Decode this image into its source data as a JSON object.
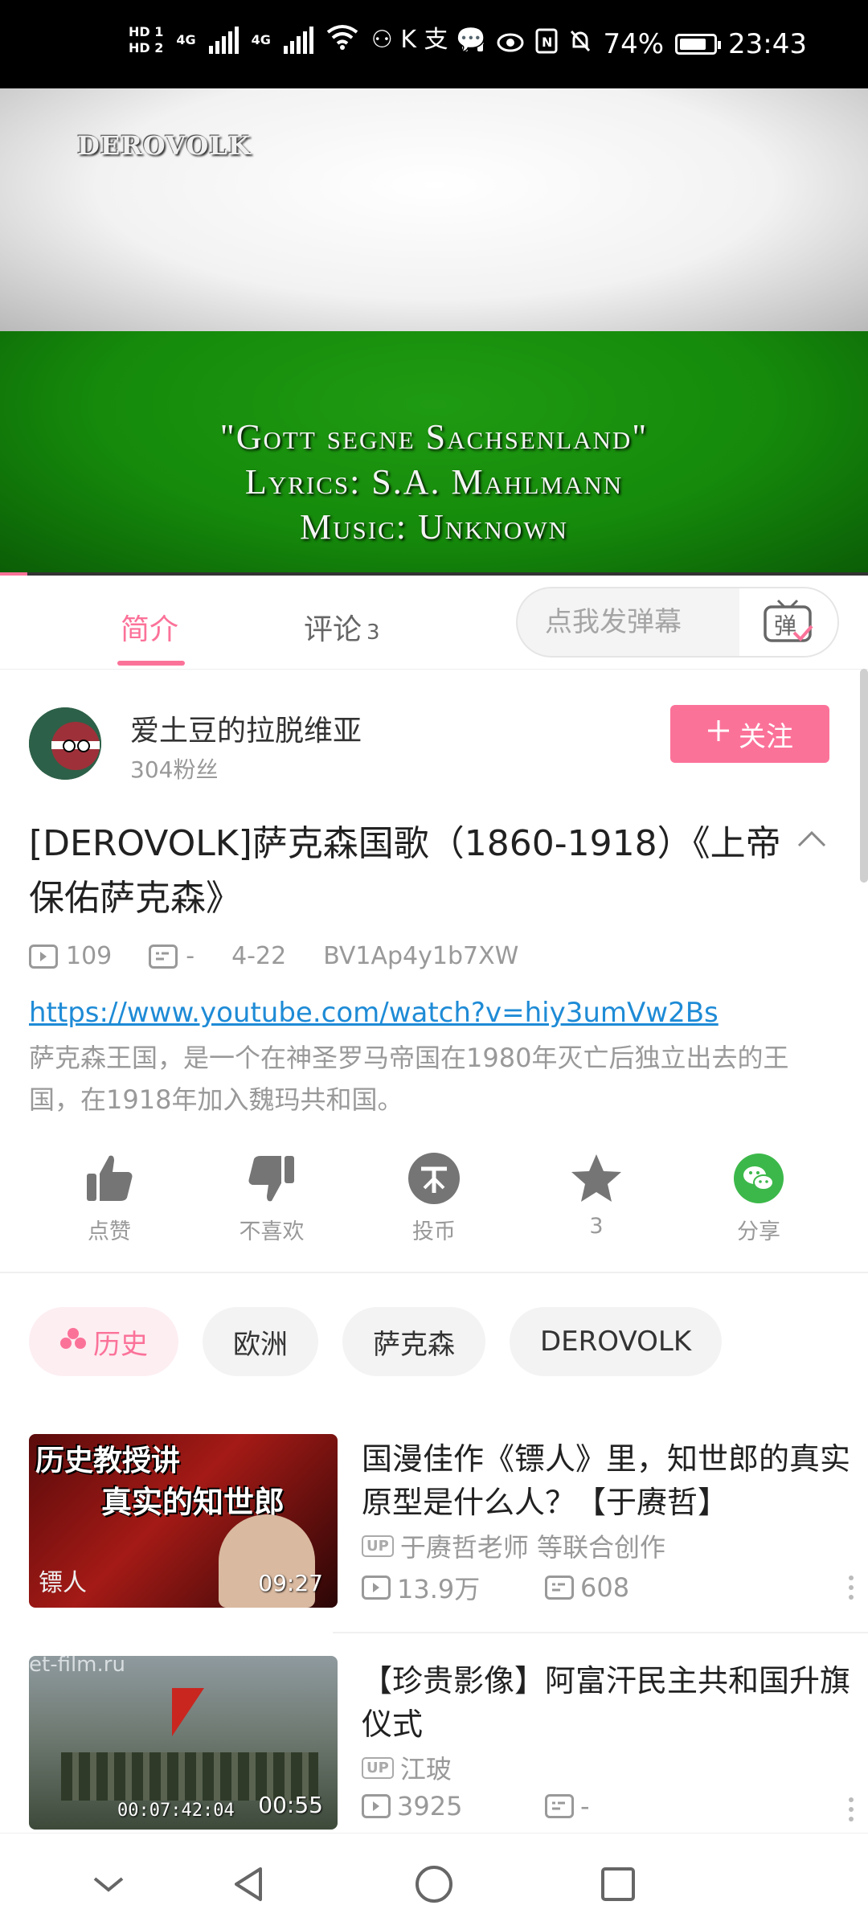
{
  "status_bar": {
    "hd1": "HD 1",
    "hd2": "HD 2",
    "net1": "4G",
    "net2": "4G",
    "app_glyphs": "⚇ K 支 💬",
    "battery": "74%",
    "time": "23:43"
  },
  "video": {
    "watermark": "DEROVOLK",
    "caption_line1": "\"Gott segne Sachsenland\"",
    "caption_line2": "Lyrics: S.A. Mahlmann",
    "caption_line3": "Music: Unknown",
    "flag_colors": {
      "top": "#ffffff",
      "bottom": "#1a9410"
    }
  },
  "tabs": {
    "intro": "简介",
    "comments": "评论",
    "comments_count": "3"
  },
  "danmaku": {
    "placeholder": "点我发弹幕",
    "button_glyph": "弹"
  },
  "uploader": {
    "name": "爱土豆的拉脱维亚",
    "fans": "304粉丝",
    "follow_label": "关注"
  },
  "video_info": {
    "title": "[DEROVOLK]萨克森国歌（1860-1918）《上帝保佑萨克森》",
    "views": "109",
    "danmaku_count": "-",
    "date": "4-22",
    "bvid": "BV1Ap4y1b7XW",
    "link": "https://www.youtube.com/watch?v=hiy3umVw2Bs",
    "description": "萨克森王国，是一个在神圣罗马帝国在1980年灭亡后独立出去的王国，在1918年加入魏玛共和国。"
  },
  "actions": {
    "like": "点赞",
    "dislike": "不喜欢",
    "coin": "投币",
    "favorite": "3",
    "share": "分享"
  },
  "tags": [
    "历史",
    "欧洲",
    "萨克森",
    "DEROVOLK"
  ],
  "related": [
    {
      "thumb_text_line1": "历史教授讲",
      "thumb_text_line2": "真实的知世郎",
      "thumb_corner": "镖人",
      "duration": "09:27",
      "title": "国漫佳作《镖人》里，知世郎的真实原型是什么人？【于赓哲】",
      "up_badge": "UP",
      "uploader": "于赓哲老师 等联合创作",
      "views": "13.9万",
      "danmaku": "608"
    },
    {
      "thumb_text_top": "et-film.ru",
      "thumb_timecode": "00:07:42:04",
      "duration": "00:55",
      "title": "【珍贵影像】阿富汗民主共和国升旗仪式",
      "up_badge": "UP",
      "uploader": "江玻",
      "views": "3925",
      "danmaku": "-"
    }
  ],
  "colors": {
    "accent": "#fb7299",
    "link": "#1e8bd6",
    "muted": "#999999",
    "share_green": "#3cb84a"
  }
}
